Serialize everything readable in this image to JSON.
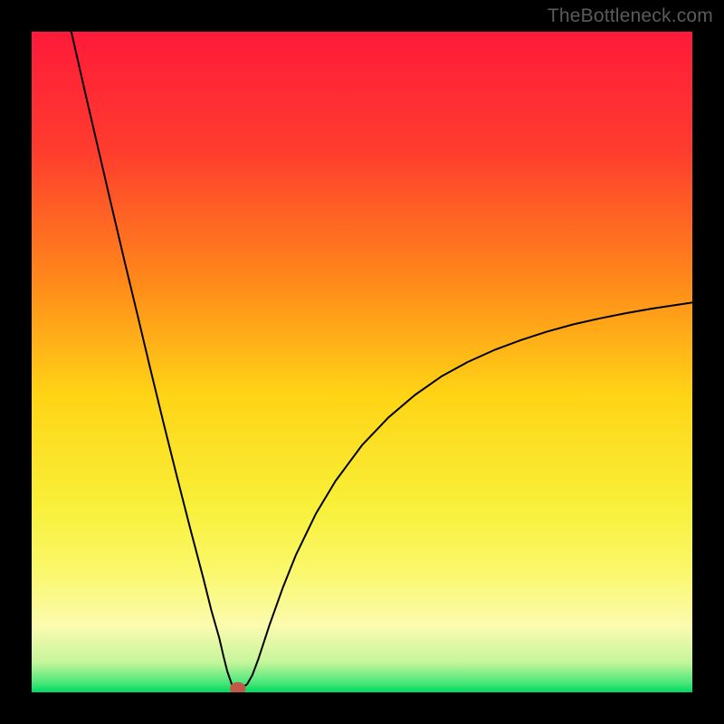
{
  "attribution": "TheBottleneck.com",
  "chart_data": {
    "type": "line",
    "title": "",
    "xlabel": "",
    "ylabel": "",
    "xlim": [
      0,
      100
    ],
    "ylim": [
      0,
      100
    ],
    "grid": false,
    "legend": false,
    "gradient_stops_vertical": [
      {
        "offset": 0.0,
        "color": "#ff1a3a"
      },
      {
        "offset": 0.18,
        "color": "#ff3c2e"
      },
      {
        "offset": 0.38,
        "color": "#ff8a1a"
      },
      {
        "offset": 0.55,
        "color": "#ffd415"
      },
      {
        "offset": 0.72,
        "color": "#f8f03a"
      },
      {
        "offset": 0.82,
        "color": "#faf86d"
      },
      {
        "offset": 0.9,
        "color": "#fbfbb0"
      },
      {
        "offset": 0.955,
        "color": "#c4f59a"
      },
      {
        "offset": 0.985,
        "color": "#4ce87a"
      },
      {
        "offset": 1.0,
        "color": "#00d860"
      }
    ],
    "series": [
      {
        "name": "bottleneck-curve",
        "color": "#000000",
        "stroke_width": 2,
        "x": [
          6.0,
          8.0,
          10.0,
          12.0,
          14.0,
          16.0,
          18.0,
          20.0,
          22.0,
          24.0,
          26.0,
          27.2,
          28.4,
          29.05,
          29.6,
          30.3,
          31.0,
          31.6,
          32.6,
          33.4,
          34.3,
          36.0,
          38.0,
          40.0,
          43.0,
          46.0,
          50.0,
          54.0,
          58.0,
          62.0,
          66.0,
          70.0,
          74.0,
          78.0,
          82.0,
          86.0,
          90.0,
          94.0,
          98.0,
          100.0
        ],
        "values": [
          100.0,
          91.2,
          82.6,
          74.0,
          65.5,
          57.2,
          48.8,
          40.6,
          32.6,
          24.8,
          17.2,
          12.4,
          8.2,
          5.4,
          3.2,
          1.2,
          0.6,
          0.6,
          1.2,
          2.6,
          5.0,
          10.2,
          15.8,
          20.8,
          27.0,
          32.0,
          37.4,
          41.6,
          45.0,
          47.8,
          50.0,
          51.8,
          53.3,
          54.6,
          55.7,
          56.6,
          57.4,
          58.1,
          58.7,
          59.0
        ]
      }
    ],
    "marker": {
      "name": "optimal-point",
      "x": 31.2,
      "y": 0.6,
      "rx_pct": 1.2,
      "ry_pct": 0.95,
      "fill": "#c2584a"
    }
  }
}
